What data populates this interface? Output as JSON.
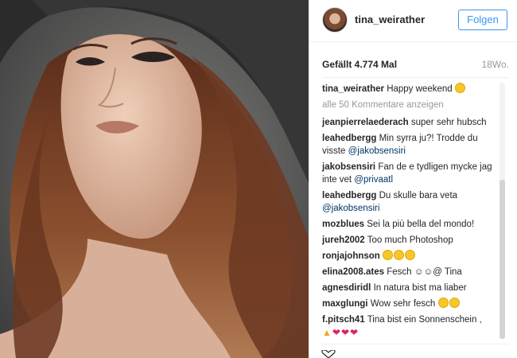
{
  "header": {
    "username": "tina_weirather",
    "follow_label": "Folgen"
  },
  "post": {
    "likes": "Gefällt 4.774 Mal",
    "time": "18Wo."
  },
  "caption": {
    "user": "tina_weirather",
    "text": "Happy weekend",
    "emoji": "smiling-face-icon"
  },
  "load_more": "alle 50 Kommentare anzeigen",
  "comments": [
    {
      "user": "jeanpierrelaederach",
      "text": "super sehr hubsch"
    },
    {
      "user": "leahedbergg",
      "text": "Min syrra ju?! Trodde du visste ",
      "mention": "@jakobsensiri"
    },
    {
      "user": "jakobsensiri",
      "text": "Fan de e tydligen mycke jag inte vet ",
      "mention": "@privaatl"
    },
    {
      "user": "leahedbergg",
      "text": "Du skulle bara veta ",
      "mention": "@jakobsensiri"
    },
    {
      "user": "mozblues",
      "text": "Sei la più bella del mondo!"
    },
    {
      "user": "jureh2002",
      "text": "Too much Photoshop"
    },
    {
      "user": "ronjajohnson",
      "text": ""
    },
    {
      "user": "elina2008.ates",
      "text": "Fesch ☺☺@ Tina"
    },
    {
      "user": "agnesdiridl",
      "text": "In natura bist ma liaber"
    },
    {
      "user": "maxglungi",
      "text": "Wow sehr fesch "
    },
    {
      "user": "f.pitsch41",
      "text": "Tina bist ein Sonnenschein ,"
    }
  ],
  "icons": {
    "heart_eyes": "heart-eyes-emoji",
    "heart": "red-heart-emoji",
    "thumb": "thumbs-up-emoji"
  },
  "colors": {
    "accent": "#3897f0",
    "text": "#262626",
    "muted": "#999999",
    "mention": "#003569"
  }
}
